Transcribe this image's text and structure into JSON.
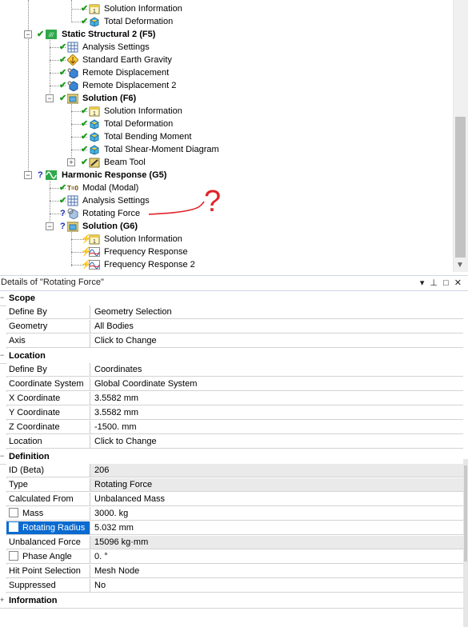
{
  "tree": {
    "nodes": [
      {
        "label": "Solution Information",
        "icon": "solution-information-icon",
        "status": "ok"
      },
      {
        "label": "Total Deformation",
        "icon": "total-deformation-icon",
        "status": "ok"
      },
      {
        "label": "Static Structural 2 (F5)",
        "icon": "static-structural-icon",
        "status": "ok"
      },
      {
        "label": "Analysis Settings",
        "icon": "analysis-settings-icon",
        "status": "ok"
      },
      {
        "label": "Standard Earth Gravity",
        "icon": "earth-gravity-icon",
        "status": "ok"
      },
      {
        "label": "Remote Displacement",
        "icon": "remote-displacement-icon",
        "status": "ok"
      },
      {
        "label": "Remote Displacement 2",
        "icon": "remote-displacement-icon",
        "status": "ok"
      },
      {
        "label": "Solution (F6)",
        "icon": "solution-icon",
        "status": "ok"
      },
      {
        "label": "Solution Information",
        "icon": "solution-information-icon",
        "status": "ok"
      },
      {
        "label": "Total Deformation",
        "icon": "total-deformation-icon",
        "status": "ok"
      },
      {
        "label": "Total Bending Moment",
        "icon": "total-bending-moment-icon",
        "status": "ok"
      },
      {
        "label": "Total Shear-Moment Diagram",
        "icon": "shear-moment-diagram-icon",
        "status": "ok"
      },
      {
        "label": "Beam Tool",
        "icon": "beam-tool-icon",
        "status": "ok"
      },
      {
        "label": "Harmonic Response (G5)",
        "icon": "harmonic-response-icon",
        "status": "question"
      },
      {
        "label": "Modal (Modal)",
        "icon": "modal-icon",
        "status": "ok"
      },
      {
        "label": "Analysis Settings",
        "icon": "analysis-settings-icon",
        "status": "ok"
      },
      {
        "label": "Rotating Force",
        "icon": "rotating-force-icon",
        "status": "question"
      },
      {
        "label": "Solution (G6)",
        "icon": "solution-icon",
        "status": "question"
      },
      {
        "label": "Solution Information",
        "icon": "solution-information-icon",
        "status": "lightning"
      },
      {
        "label": "Frequency Response",
        "icon": "frequency-response-icon",
        "status": "lightning"
      },
      {
        "label": "Frequency Response 2",
        "icon": "frequency-response-icon",
        "status": "lightning"
      }
    ],
    "status_glyphs": {
      "ok": "✔",
      "question": "?",
      "lightning": "⚡"
    },
    "annotation_mark": "?"
  },
  "details": {
    "title": "Details of \"Rotating Force\"",
    "pin_glyph": "▾ ⊥ □ ✕",
    "sections": {
      "scope": "Scope",
      "location": "Location",
      "definition": "Definition",
      "information": "Information"
    },
    "rows": {
      "scope_define_by": {
        "label": "Define By",
        "value": "Geometry Selection"
      },
      "geometry": {
        "label": "Geometry",
        "value": "All Bodies"
      },
      "axis": {
        "label": "Axis",
        "value": "Click to Change"
      },
      "loc_define_by": {
        "label": "Define By",
        "value": "Coordinates"
      },
      "coord_system": {
        "label": "Coordinate System",
        "value": "Global Coordinate System"
      },
      "x_coord": {
        "label": "X Coordinate",
        "value": "3.5582 mm"
      },
      "y_coord": {
        "label": "Y Coordinate",
        "value": "3.5582 mm"
      },
      "z_coord": {
        "label": "Z Coordinate",
        "value": "-1500. mm"
      },
      "location": {
        "label": "Location",
        "value": "Click to Change"
      },
      "id": {
        "label": "ID (Beta)",
        "value": "206"
      },
      "type": {
        "label": "Type",
        "value": "Rotating Force"
      },
      "calc_from": {
        "label": "Calculated From",
        "value": "Unbalanced Mass"
      },
      "mass": {
        "label": "Mass",
        "value": "3000. kg"
      },
      "rot_radius": {
        "label": "Rotating Radius",
        "value": "5.032 mm"
      },
      "unbalanced_force": {
        "label": "Unbalanced Force",
        "value": "15096 kg·mm"
      },
      "phase_angle": {
        "label": "Phase Angle",
        "value": "0. °"
      },
      "hit_point": {
        "label": "Hit Point Selection",
        "value": "Mesh Node"
      },
      "suppressed": {
        "label": "Suppressed",
        "value": "No"
      }
    }
  },
  "colors": {
    "ok_green": "#1a9a1a",
    "question_blue": "#1c2bc0",
    "lightning_red": "#e52020",
    "selection_blue": "#0b6bd0",
    "annotation_red": "#e0242a"
  }
}
